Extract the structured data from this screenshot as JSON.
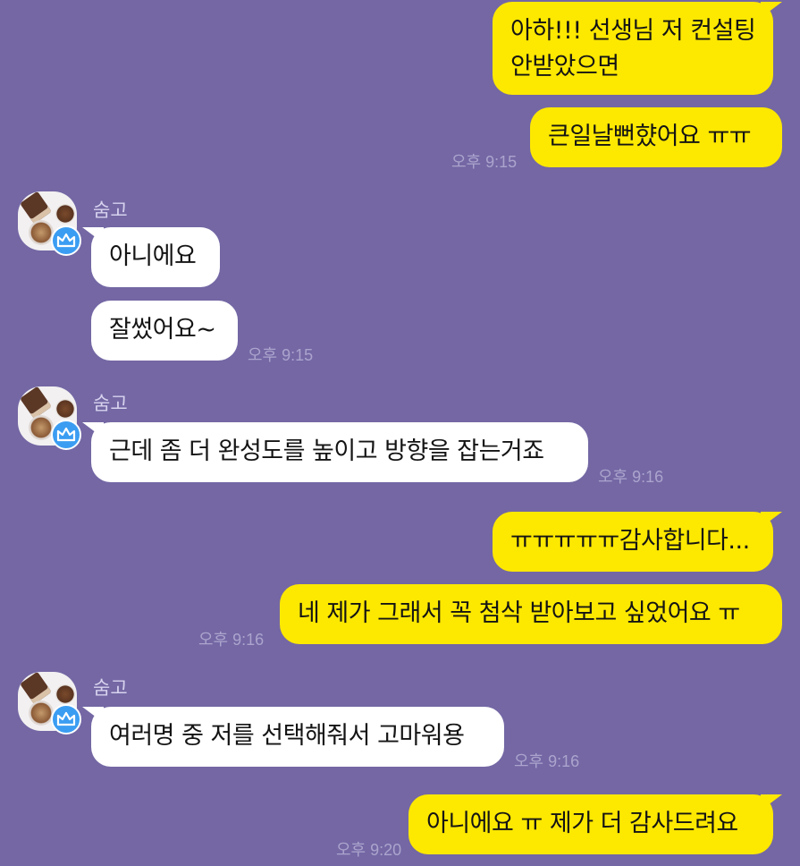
{
  "colors": {
    "background": "#7467a4",
    "my_bubble": "#fde800",
    "their_bubble": "#ffffff",
    "badge": "#3b9df2"
  },
  "messages": [
    {
      "from": "me",
      "text": "아하!!! 선생님 저 컨설팅",
      "text2": "안받았으면"
    },
    {
      "from": "me",
      "text": "큰일날뻔햤어요 ㅠㅠ",
      "time": "오후 9:15"
    },
    {
      "from": "them",
      "sender": "숨고",
      "text": "아니에요"
    },
    {
      "from": "them",
      "text": "잘썼어요~",
      "time": "오후 9:15"
    },
    {
      "from": "them",
      "sender": "숨고",
      "text": "근데 좀 더 완성도를 높이고 방향을 잡는거죠",
      "time": "오후 9:16"
    },
    {
      "from": "me",
      "text": "ㅠㅠㅠㅠㅠ감사합니다..."
    },
    {
      "from": "me",
      "text": "네 제가 그래서 꼭 첨삭 받아보고 싶었어요 ㅠ",
      "time": "오후 9:16"
    },
    {
      "from": "them",
      "sender": "숨고",
      "text": "여러명 중 저를 선택해줘서 고마워용",
      "time": "오후 9:16"
    },
    {
      "from": "me",
      "text": "아니에요 ㅠ 제가 더 감사드려요",
      "time": "오후 9:20"
    }
  ]
}
